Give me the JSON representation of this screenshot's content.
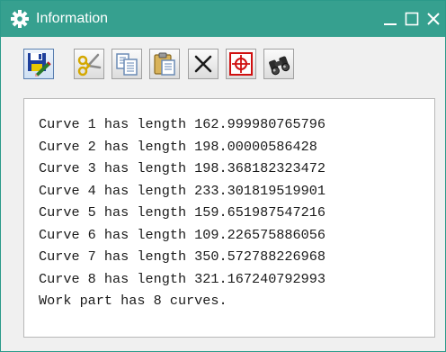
{
  "window": {
    "title": "Information",
    "controls": {
      "minimize": "_",
      "close": "✕"
    }
  },
  "toolbar": {
    "buttons": [
      {
        "icon": "save-info-icon"
      },
      {
        "icon": "cut-icon"
      },
      {
        "icon": "copy-icon"
      },
      {
        "icon": "paste-icon"
      },
      {
        "icon": "delete-icon"
      },
      {
        "icon": "crosshair-icon"
      },
      {
        "icon": "binoculars-icon"
      }
    ]
  },
  "info": {
    "lines": [
      "Curve 1 has length 162.999980765796",
      "Curve 2 has length 198.00000586428",
      "Curve 3 has length 198.368182323472",
      "Curve 4 has length 233.301819519901",
      "Curve 5 has length 159.651987547216",
      "Curve 6 has length 109.226575886056",
      "Curve 7 has length 350.572788226968",
      "Curve 8 has length 321.167240792993",
      "Work part has 8 curves."
    ]
  },
  "colors": {
    "titlebar": "#36a08f",
    "accent_red": "#d01010"
  }
}
